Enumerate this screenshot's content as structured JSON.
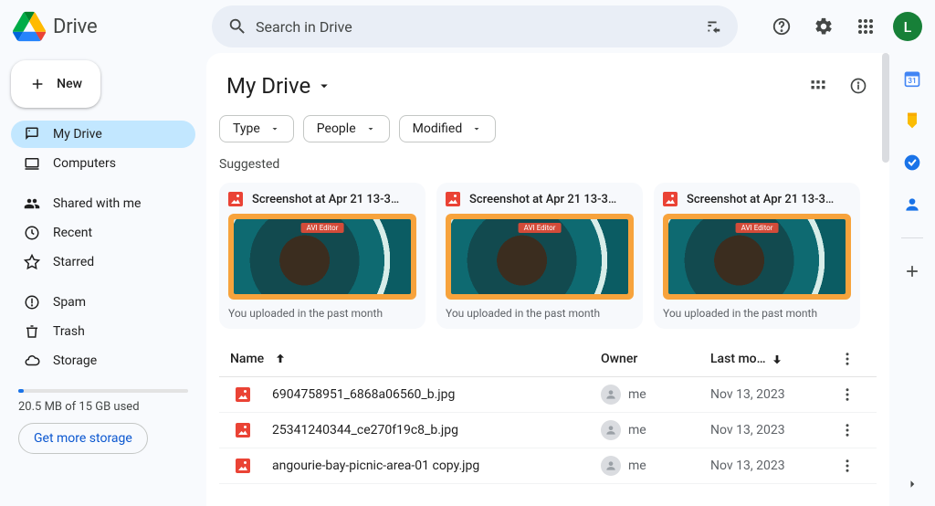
{
  "brand": {
    "name": "Drive"
  },
  "search": {
    "placeholder": "Search in Drive"
  },
  "avatar_letter": "L",
  "new_button": "New",
  "sidebar": {
    "items": [
      {
        "label": "My Drive",
        "icon": "drive"
      },
      {
        "label": "Computers",
        "icon": "computers"
      },
      {
        "label": "Shared with me",
        "icon": "shared"
      },
      {
        "label": "Recent",
        "icon": "recent"
      },
      {
        "label": "Starred",
        "icon": "starred"
      },
      {
        "label": "Spam",
        "icon": "spam"
      },
      {
        "label": "Trash",
        "icon": "trash"
      },
      {
        "label": "Storage",
        "icon": "storage"
      }
    ],
    "storage_text": "20.5 MB of 15 GB used",
    "storage_cta": "Get more storage"
  },
  "main": {
    "title": "My Drive",
    "filters": [
      "Type",
      "People",
      "Modified"
    ],
    "suggested_label": "Suggested",
    "cards": [
      {
        "title": "Screenshot at Apr 21 13-3…",
        "sub": "You uploaded in the past month"
      },
      {
        "title": "Screenshot at Apr 21 13-3…",
        "sub": "You uploaded in the past month"
      },
      {
        "title": "Screenshot at Apr 21 13-3…",
        "sub": "You uploaded in the past month"
      }
    ],
    "columns": {
      "name": "Name",
      "owner": "Owner",
      "modified": "Last mo…"
    },
    "owner_me": "me",
    "rows": [
      {
        "name": "6904758951_6868a06560_b.jpg",
        "owner": "me",
        "modified": "Nov 13, 2023"
      },
      {
        "name": "25341240344_ce270f19c8_b.jpg",
        "owner": "me",
        "modified": "Nov 13, 2023"
      },
      {
        "name": "angourie-bay-picnic-area-01 copy.jpg",
        "owner": "me",
        "modified": "Nov 13, 2023"
      }
    ]
  }
}
